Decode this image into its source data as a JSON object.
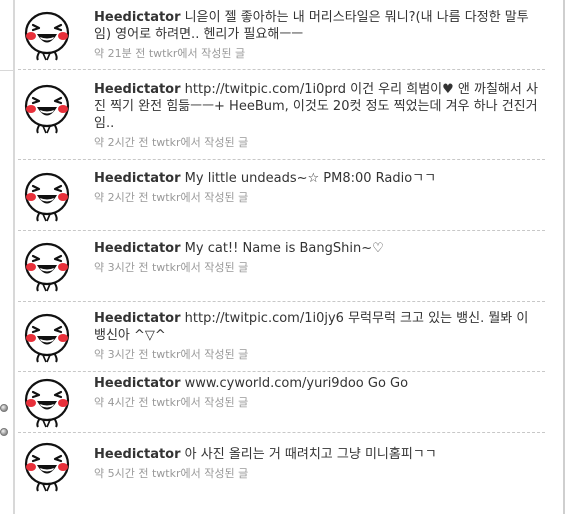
{
  "tweets": [
    {
      "author": "Heedictator",
      "text": "니읃이 젤 좋아하는 내 머리스타일은 뭐니?(내 나름 다정한 말투임) 영어로 하려면.. 헨리가 필요해ㅡㅡ",
      "meta": "약 21분 전 twtkr에서 작성된 글"
    },
    {
      "author": "Heedictator",
      "text": "http://twitpic.com/1i0prd 이건 우리 희범이♥ 앤 까칠해서 사진 찍기 완전 힘듦ㅡㅡ+ HeeBum, 이것도 20컷 정도 찍었는데 겨우 하나 건진거임..",
      "meta": "약 2시간 전 twtkr에서 작성된 글"
    },
    {
      "author": "Heedictator",
      "text": "My little undeads~☆ PM8:00 Radioㄱㄱ",
      "meta": "약 2시간 전 twtkr에서 작성된 글"
    },
    {
      "author": "Heedictator",
      "text": "My cat!! Name is BangShin~♡",
      "meta": "약 3시간 전 twtkr에서 작성된 글"
    },
    {
      "author": "Heedictator",
      "text": "http://twitpic.com/1i0jy6 무럭무럭 크고 있는 뱅신. 뭘봐 이 뱅신아 ^▽^",
      "meta": "약 3시간 전 twtkr에서 작성된 글"
    },
    {
      "author": "Heedictator",
      "text": "www.cyworld.com/yuri9doo Go Go",
      "meta": "약 4시간 전 twtkr에서 작성된 글"
    },
    {
      "author": "Heedictator",
      "text": "아 사진 올리는 거 때려치고 그냥 미니홈피ㄱㄱ",
      "meta": "약 5시간 전 twtkr에서 작성된 글"
    }
  ],
  "avatar_icon": "grinning-face-doodle-avatar",
  "colors": {
    "author": "#333333",
    "text": "#333333",
    "meta": "#999999",
    "divider": "#c8c8c8",
    "cheek": "#e8303a"
  }
}
